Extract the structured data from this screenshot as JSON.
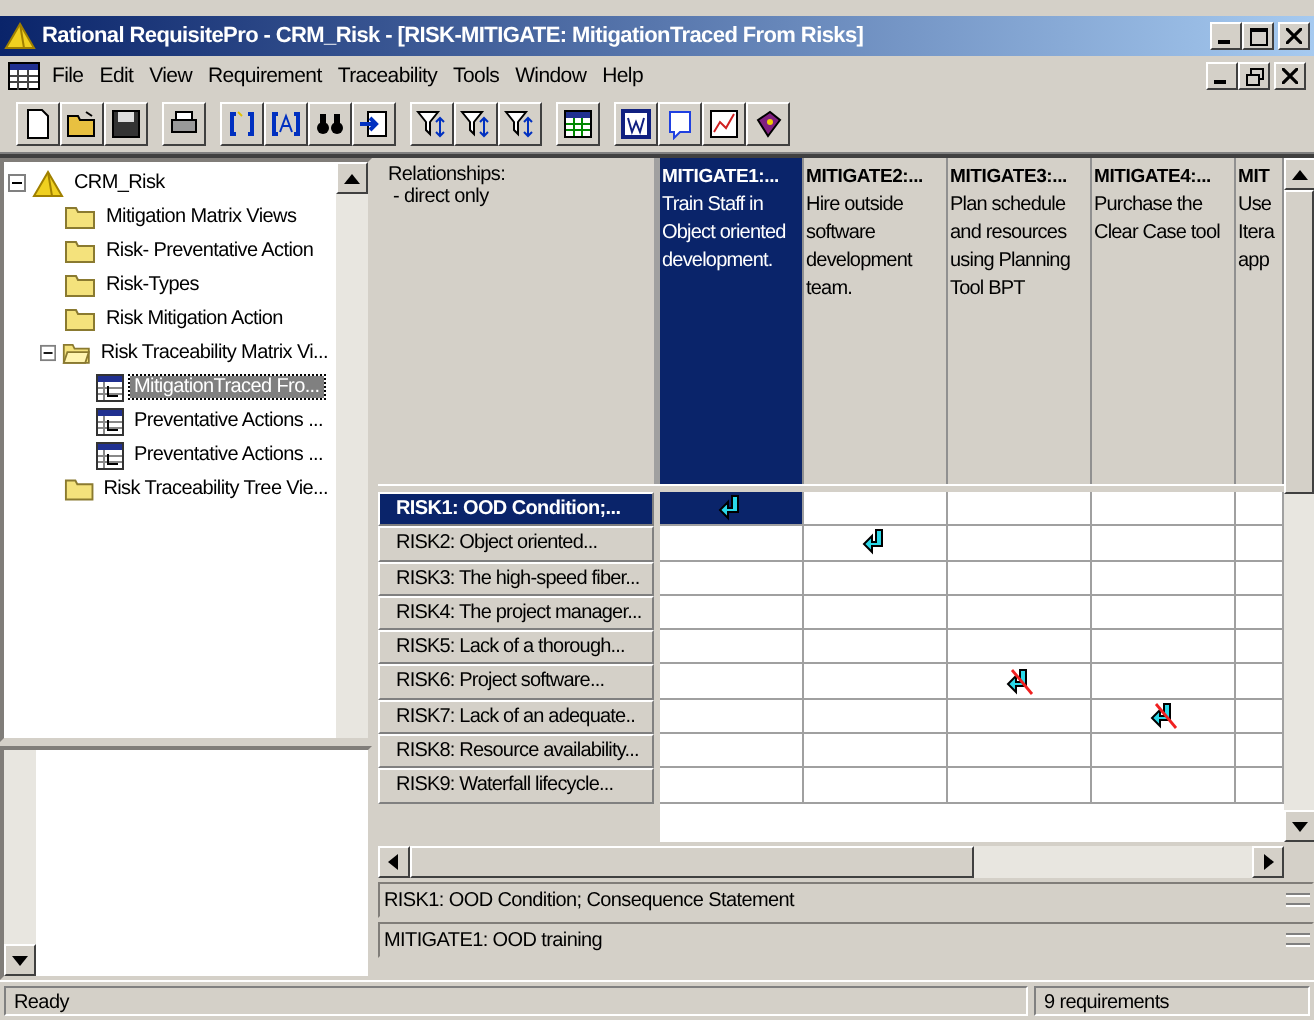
{
  "window": {
    "title": "Rational RequisitePro - CRM_Risk - [RISK-MITIGATE: MitigationTraced From Risks]"
  },
  "menu": [
    "File",
    "Edit",
    "View",
    "Requirement",
    "Traceability",
    "Tools",
    "Window",
    "Help"
  ],
  "tree": [
    {
      "label": "CRM_Risk",
      "kind": "project",
      "expanded": true,
      "selected": false,
      "children": [
        {
          "label": "Mitigation Matrix Views",
          "kind": "folder",
          "expanded": false,
          "selected": false
        },
        {
          "label": "Risk- Preventative Action",
          "kind": "folder",
          "expanded": false,
          "selected": false
        },
        {
          "label": "Risk-Types",
          "kind": "folder",
          "expanded": false,
          "selected": false
        },
        {
          "label": "Risk Mitigation Action",
          "kind": "folder",
          "expanded": false,
          "selected": false
        },
        {
          "label": "Risk Traceability Matrix Vi...",
          "kind": "folder",
          "expanded": true,
          "selected": false,
          "children": [
            {
              "label": "MitigationTraced Fro...",
              "kind": "view",
              "selected": true
            },
            {
              "label": "Preventative Actions ...",
              "kind": "view",
              "selected": false
            },
            {
              "label": "Preventative Actions ...",
              "kind": "view",
              "selected": false
            }
          ]
        },
        {
          "label": "Risk Traceability Tree Vie...",
          "kind": "folder",
          "expanded": false,
          "selected": false
        }
      ]
    }
  ],
  "matrix": {
    "corner": [
      "Relationships:",
      " - direct only"
    ],
    "columns": [
      {
        "id": "MITIGATE1:...",
        "text": [
          "Train Staff in",
          "Object oriented",
          "development."
        ],
        "selected": true
      },
      {
        "id": "MITIGATE2:...",
        "text": [
          "Hire outside",
          "software",
          "development",
          "team."
        ],
        "selected": false
      },
      {
        "id": "MITIGATE3:...",
        "text": [
          "Plan schedule",
          "and resources",
          "using Planning",
          "Tool  BPT"
        ],
        "selected": false
      },
      {
        "id": "MITIGATE4:...",
        "text": [
          "Purchase the",
          "Clear Case tool"
        ],
        "selected": false
      },
      {
        "id": "MIT",
        "text": [
          "Use",
          "Itera",
          "app"
        ],
        "selected": false
      }
    ],
    "rows": [
      {
        "label": "RISK1: OOD Condition;...",
        "selected": true,
        "cells": [
          {
            "traced": true,
            "suspect": false
          },
          {
            "traced": false,
            "suspect": false
          },
          {
            "traced": false,
            "suspect": false
          },
          {
            "traced": false,
            "suspect": false
          },
          {
            "traced": false,
            "suspect": false
          }
        ]
      },
      {
        "label": "RISK2: Object oriented...",
        "selected": false,
        "cells": [
          {
            "traced": false,
            "suspect": false
          },
          {
            "traced": true,
            "suspect": false
          },
          {
            "traced": false,
            "suspect": false
          },
          {
            "traced": false,
            "suspect": false
          },
          {
            "traced": false,
            "suspect": false
          }
        ]
      },
      {
        "label": "RISK3: The high-speed fiber...",
        "selected": false,
        "cells": [
          {
            "traced": false,
            "suspect": false
          },
          {
            "traced": false,
            "suspect": false
          },
          {
            "traced": false,
            "suspect": false
          },
          {
            "traced": false,
            "suspect": false
          },
          {
            "traced": false,
            "suspect": false
          }
        ]
      },
      {
        "label": "RISK4: The project manager...",
        "selected": false,
        "cells": [
          {
            "traced": false,
            "suspect": false
          },
          {
            "traced": false,
            "suspect": false
          },
          {
            "traced": false,
            "suspect": false
          },
          {
            "traced": false,
            "suspect": false
          },
          {
            "traced": false,
            "suspect": false
          }
        ]
      },
      {
        "label": "RISK5: Lack of a thorough...",
        "selected": false,
        "cells": [
          {
            "traced": false,
            "suspect": false
          },
          {
            "traced": false,
            "suspect": false
          },
          {
            "traced": false,
            "suspect": false
          },
          {
            "traced": false,
            "suspect": false
          },
          {
            "traced": false,
            "suspect": false
          }
        ]
      },
      {
        "label": "RISK6: Project software...",
        "selected": false,
        "cells": [
          {
            "traced": false,
            "suspect": false
          },
          {
            "traced": false,
            "suspect": false
          },
          {
            "traced": true,
            "suspect": true
          },
          {
            "traced": false,
            "suspect": false
          },
          {
            "traced": false,
            "suspect": false
          }
        ]
      },
      {
        "label": "RISK7: Lack of an adequate..",
        "selected": false,
        "cells": [
          {
            "traced": false,
            "suspect": false
          },
          {
            "traced": false,
            "suspect": false
          },
          {
            "traced": false,
            "suspect": false
          },
          {
            "traced": true,
            "suspect": true
          },
          {
            "traced": false,
            "suspect": false
          }
        ]
      },
      {
        "label": "RISK8: Resource availability...",
        "selected": false,
        "cells": [
          {
            "traced": false,
            "suspect": false
          },
          {
            "traced": false,
            "suspect": false
          },
          {
            "traced": false,
            "suspect": false
          },
          {
            "traced": false,
            "suspect": false
          },
          {
            "traced": false,
            "suspect": false
          }
        ]
      },
      {
        "label": "RISK9: Waterfall lifecycle...",
        "selected": false,
        "cells": [
          {
            "traced": false,
            "suspect": false
          },
          {
            "traced": false,
            "suspect": false
          },
          {
            "traced": false,
            "suspect": false
          },
          {
            "traced": false,
            "suspect": false
          },
          {
            "traced": false,
            "suspect": false
          }
        ]
      }
    ]
  },
  "info_bars": [
    "RISK1: OOD Condition; Consequence Statement",
    "MITIGATE1: OOD training"
  ],
  "status_bar": {
    "message": "Ready",
    "count": "9 requirements"
  }
}
